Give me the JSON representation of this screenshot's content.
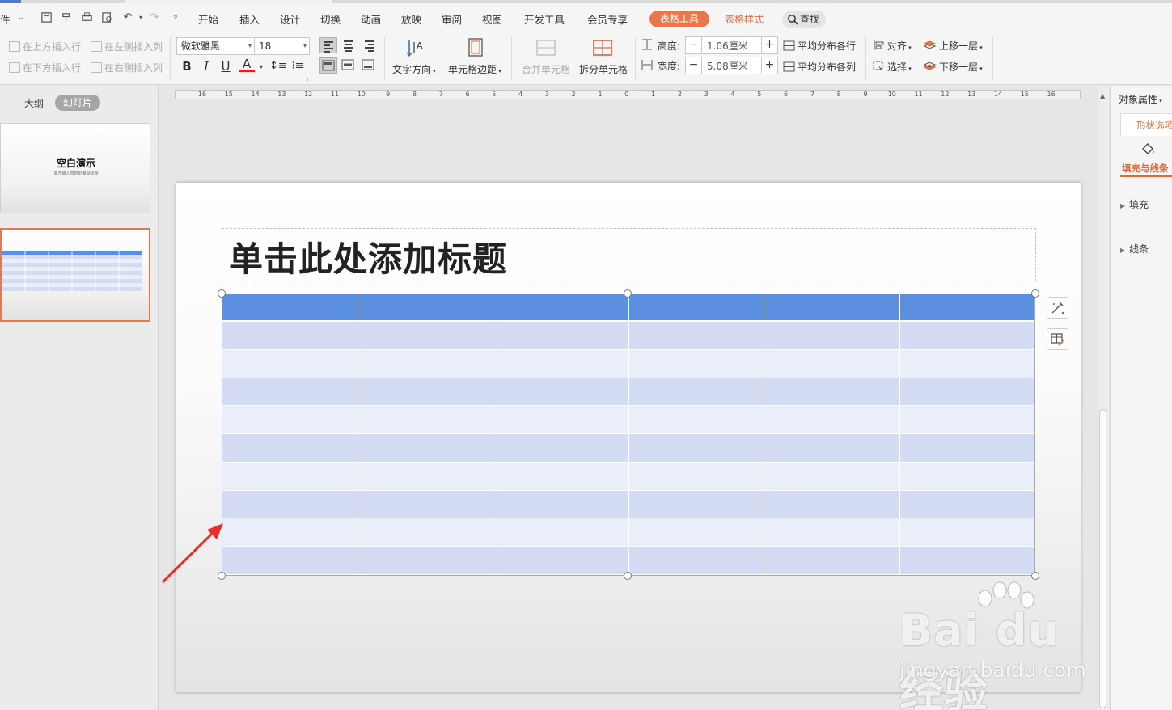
{
  "menubar": {
    "file_fragment": "件",
    "tabs": [
      "开始",
      "插入",
      "设计",
      "切换",
      "动画",
      "放映",
      "审阅",
      "视图",
      "开发工具",
      "会员专享"
    ],
    "active_tab": "表格工具",
    "context_tab": "表格样式",
    "search_label": "查找"
  },
  "ribbon": {
    "insert_above": "在上方插入行",
    "insert_below": "在下方插入行",
    "insert_left": "在左侧插入列",
    "insert_right": "在右侧插入列",
    "font_name": "微软雅黑",
    "font_size": "18",
    "bold": "B",
    "italic": "I",
    "underline": "U",
    "font_color": "A",
    "text_direction": "文字方向",
    "cell_margin": "单元格边距",
    "merge_cells": "合并单元格",
    "split_cells": "拆分单元格",
    "height_label": "高度:",
    "height_value": "1.06厘米",
    "width_label": "宽度:",
    "width_value": "5.08厘米",
    "distribute_rows": "平均分布各行",
    "distribute_cols": "平均分布各列",
    "align": "对齐",
    "select": "选择",
    "bring_forward": "上移一层",
    "send_backward": "下移一层"
  },
  "left_panel": {
    "tab_outline": "大纲",
    "tab_slides": "幻灯片",
    "slide1_title": "空白演示",
    "slide1_subtitle": "单击输入您的封面副标题"
  },
  "ruler": {
    "labels": [
      "16",
      "15",
      "14",
      "13",
      "12",
      "11",
      "10",
      "9",
      "8",
      "7",
      "6",
      "5",
      "4",
      "3",
      "2",
      "1",
      "0",
      "1",
      "2",
      "3",
      "4",
      "5",
      "6",
      "7",
      "8",
      "9",
      "10",
      "11",
      "12",
      "13",
      "14",
      "15",
      "16"
    ]
  },
  "slide": {
    "title_placeholder": "单击此处添加标题",
    "table": {
      "rows": 10,
      "cols": 6
    }
  },
  "right_panel": {
    "title": "对象属性",
    "tab_shape_options": "形状选项",
    "fill_and_line": "填充与线条",
    "section_fill": "填充",
    "section_line": "线条"
  },
  "watermark": {
    "main": "Bai du 经验",
    "sub": "jingyan.baidu.com"
  },
  "colors": {
    "accent_orange": "#e8784a",
    "table_header": "#5b8fe0",
    "table_band_dark": "#d3dcf3",
    "table_band_light": "#eaeef8",
    "arrow_red": "#e8302a"
  }
}
